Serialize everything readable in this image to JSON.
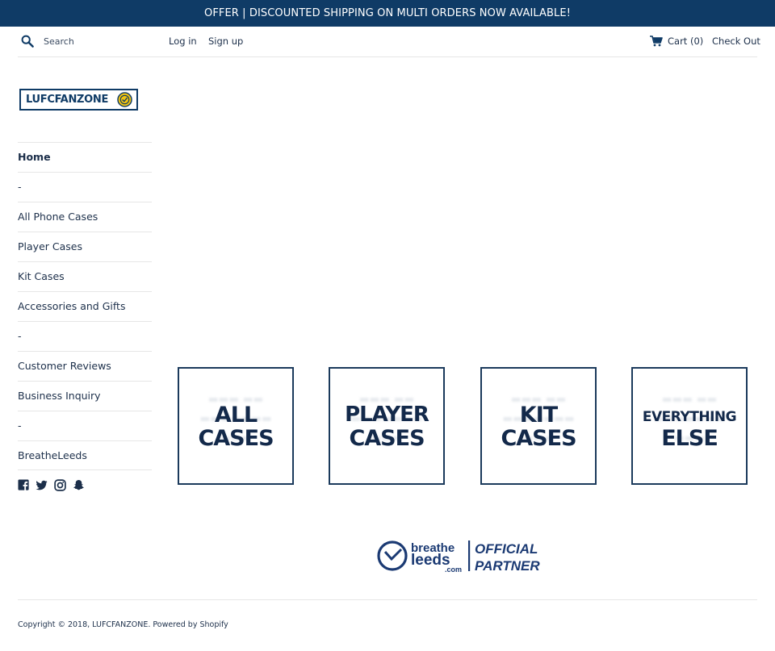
{
  "announcement": "OFFER | DISCOUNTED SHIPPING ON MULTI ORDERS NOW AVAILABLE!",
  "header": {
    "search_placeholder": "Search",
    "login": "Log in",
    "signup": "Sign up",
    "cart": "Cart (0)",
    "checkout": "Check Out",
    "icons": [
      "search-icon",
      "cart-icon"
    ]
  },
  "logo": {
    "text": "LUFCFANZONE"
  },
  "sidebar": {
    "items": [
      {
        "label": "Home",
        "active": true
      },
      {
        "label": "-"
      },
      {
        "label": "All Phone Cases"
      },
      {
        "label": "Player Cases"
      },
      {
        "label": "Kit Cases"
      },
      {
        "label": "Accessories and Gifts"
      },
      {
        "label": "-"
      },
      {
        "label": "Customer Reviews"
      },
      {
        "label": "Business Inquiry"
      },
      {
        "label": "-"
      },
      {
        "label": "BreatheLeeds"
      }
    ],
    "socials": [
      "facebook-icon",
      "twitter-icon",
      "instagram-icon",
      "snapchat-icon"
    ]
  },
  "collections": [
    {
      "line1": "ALL",
      "line2": "CASES"
    },
    {
      "line1": "PLAYER",
      "line2": "CASES"
    },
    {
      "line1": "KIT",
      "line2": "CASES"
    },
    {
      "line1": "EVERYTHING",
      "line2": "ELSE"
    }
  ],
  "partner": {
    "brand_line1": "breathe",
    "brand_line2": "leeds",
    "brand_suffix": ".com",
    "tag_line1": "OFFICIAL",
    "tag_line2": "PARTNER"
  },
  "footer": {
    "copyright": "Copyright © 2018, LUFCFANZONE. Powered by Shopify"
  },
  "colors": {
    "brand": "#0f3b66",
    "text": "#1c2f4a",
    "divider": "#e6e6e6"
  }
}
